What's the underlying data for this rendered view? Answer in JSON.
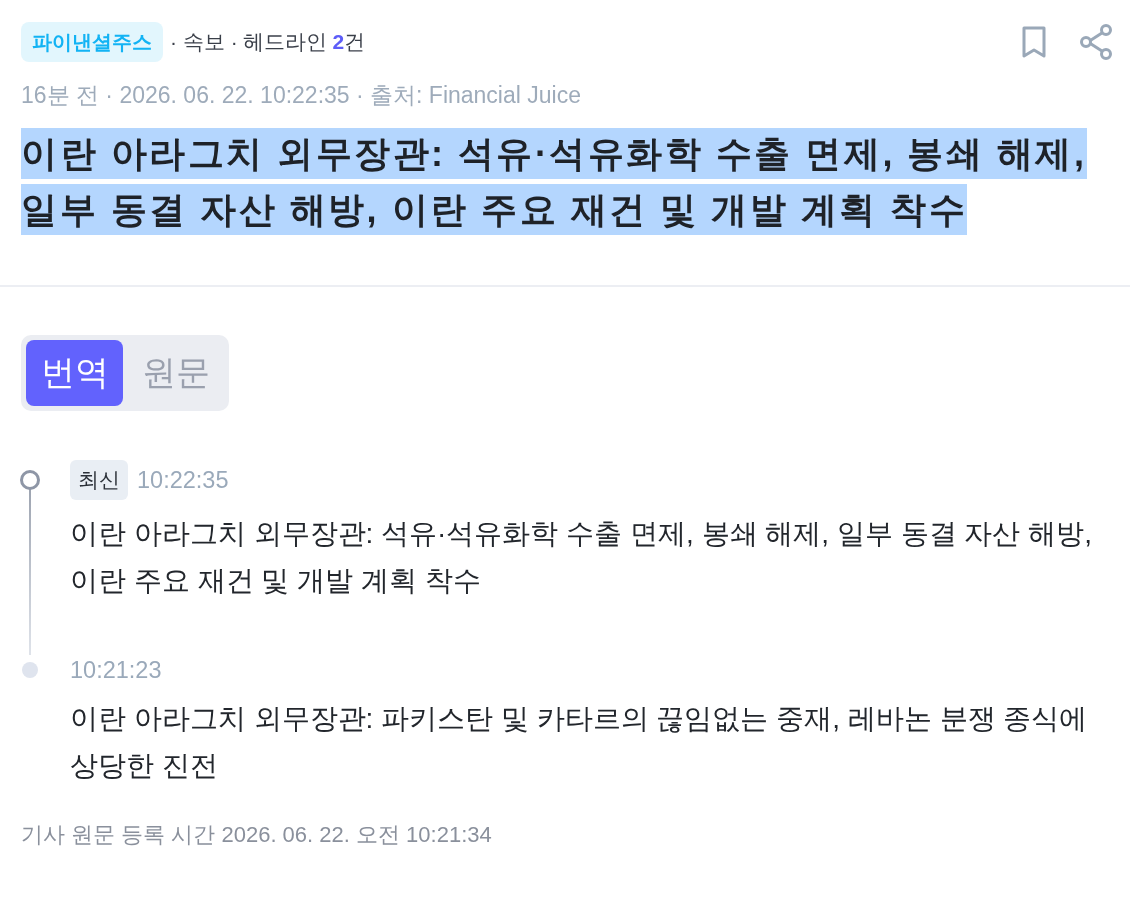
{
  "header": {
    "source_badge": "파이낸셜주스",
    "breadcrumb": "· 속보 · 헤드라인",
    "count": "2",
    "count_unit": "건"
  },
  "meta": "16분 전 · 2026. 06. 22. 10:22:35 · 출처: Financial Juice",
  "headline": {
    "text": "이란 아라그치 외무장관: 석유·석유화학 수출 면제, 봉쇄 해제, 일부 동결 자산 해방, 이란 주요 재건 및 개발 계획 착수",
    "highlighted": true
  },
  "view_tabs": [
    {
      "label": "번역",
      "selected": true
    },
    {
      "label": "원문",
      "selected": false
    }
  ],
  "timeline": [
    {
      "badge": "최신",
      "time": "10:22:35",
      "text": "이란 아라그치 외무장관: 석유·석유화학 수출 면제, 봉쇄 해제, 일부 동결 자산 해방, 이란 주요 재건 및 개발 계획 착수",
      "latest": true
    },
    {
      "time": "10:21:23",
      "text": "이란 아라그치 외무장관: 파키스탄 및 카타르의 끊임없는 중재, 레바논 분쟁 종식에 상당한 진전",
      "latest": false
    }
  ],
  "footer": "기사 원문 등록 시간 2026. 06. 22. 오전 10:21:34"
}
